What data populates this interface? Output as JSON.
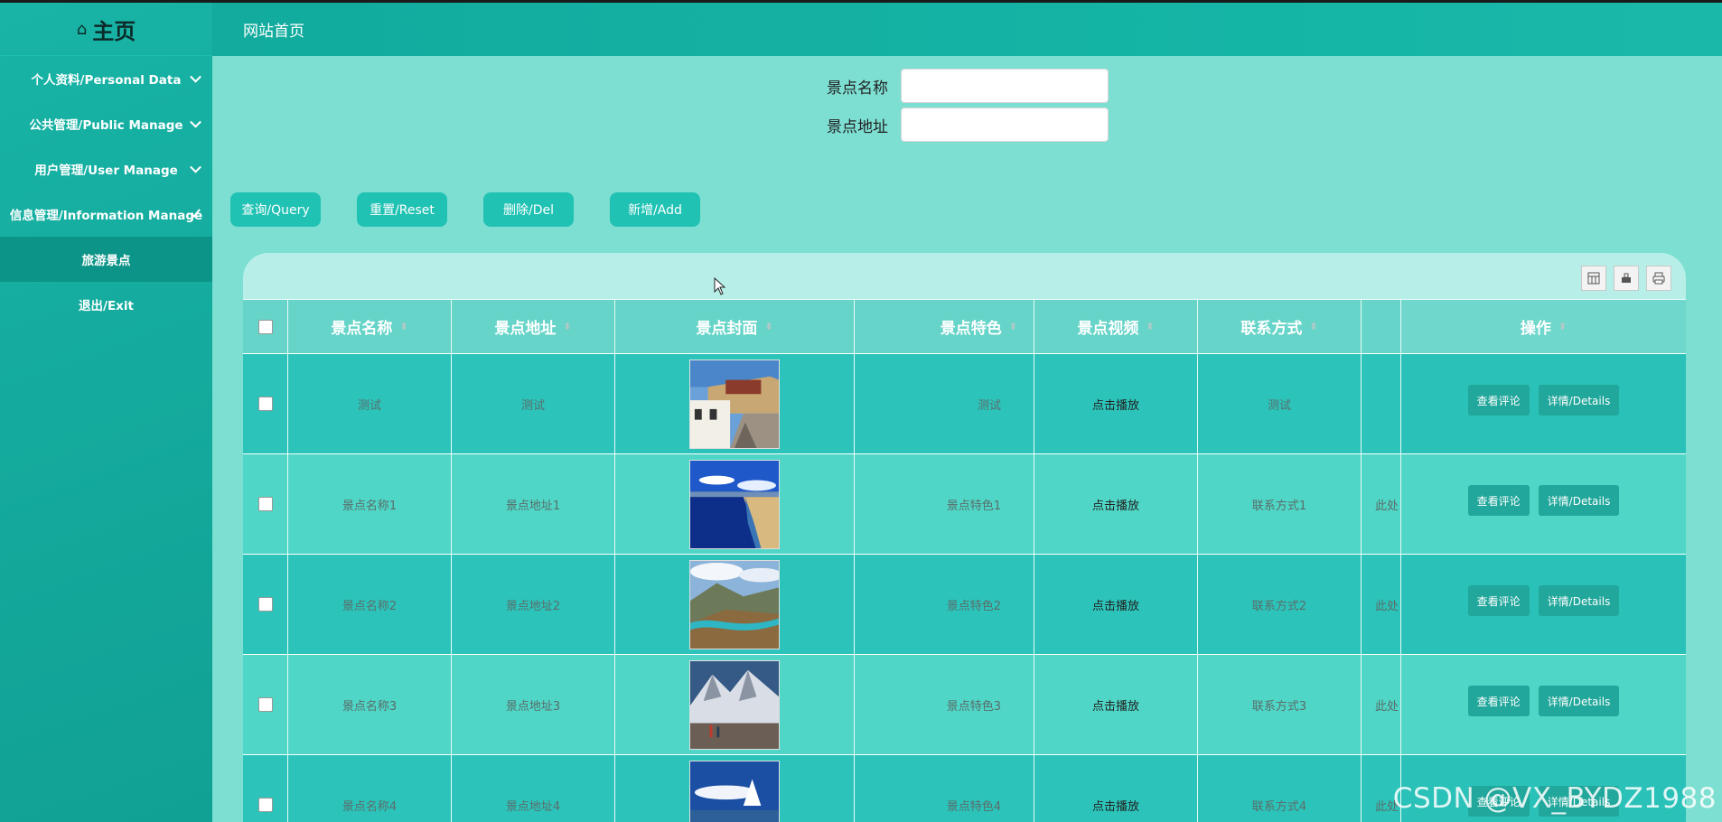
{
  "sidebar": {
    "logo_text": "主页",
    "items": [
      {
        "label": "个人资料/Personal Data"
      },
      {
        "label": "公共管理/Public Manage"
      },
      {
        "label": "用户管理/User Manage"
      },
      {
        "label": "信息管理/Information Manage"
      },
      {
        "label": "旅游景点"
      },
      {
        "label": "退出/Exit"
      }
    ]
  },
  "header": {
    "title": "网站首页"
  },
  "search": {
    "name_label": "景点名称",
    "name_value": "",
    "address_label": "景点地址",
    "address_value": ""
  },
  "toolbar": {
    "query": "查询/Query",
    "reset": "重置/Reset",
    "delete": "删除/Del",
    "add": "新增/Add"
  },
  "table": {
    "headers": {
      "name": "景点名称",
      "address": "景点地址",
      "cover": "景点封面",
      "feature": "景点特色",
      "video": "景点视频",
      "contact": "联系方式",
      "actions": "操作"
    },
    "rows": [
      {
        "name": "测试",
        "address": "测试",
        "feature": "测试",
        "video": "点击播放",
        "contact": "测试",
        "extra": ""
      },
      {
        "name": "景点名称1",
        "address": "景点地址1",
        "feature": "景点特色1",
        "video": "点击播放",
        "contact": "联系方式1",
        "extra": "此处"
      },
      {
        "name": "景点名称2",
        "address": "景点地址2",
        "feature": "景点特色2",
        "video": "点击播放",
        "contact": "联系方式2",
        "extra": "此处"
      },
      {
        "name": "景点名称3",
        "address": "景点地址3",
        "feature": "景点特色3",
        "video": "点击播放",
        "contact": "联系方式3",
        "extra": "此处"
      },
      {
        "name": "景点名称4",
        "address": "景点地址4",
        "feature": "景点特色4",
        "video": "点击播放",
        "contact": "联系方式4",
        "extra": "此处"
      }
    ],
    "row_actions": {
      "comments": "查看评论",
      "details": "详情/Details"
    }
  },
  "watermark": "CSDN @VX_BYDZ1988",
  "colors": {
    "accent": "#20c2b3",
    "sidebar": "#13a89b",
    "active": "#0d9488"
  }
}
